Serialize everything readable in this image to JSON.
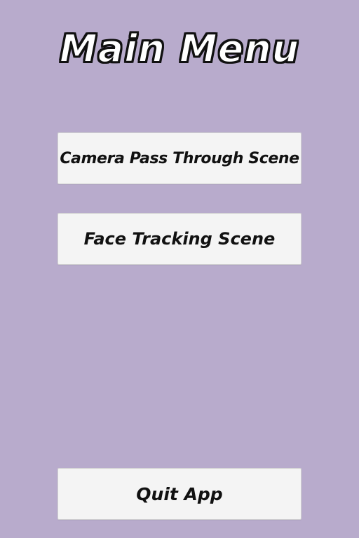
{
  "screen": {
    "background_color": "#b8abcc"
  },
  "header": {
    "title": "Main Menu"
  },
  "menu": {
    "buttons": [
      {
        "label": "Camera Pass Through Scene"
      },
      {
        "label": "Face Tracking Scene"
      }
    ],
    "quit_label": "Quit App"
  },
  "colors": {
    "button_background": "#f4f4f4",
    "button_text": "#111111",
    "title_fill": "#ffffff",
    "title_outline": "#111111"
  }
}
